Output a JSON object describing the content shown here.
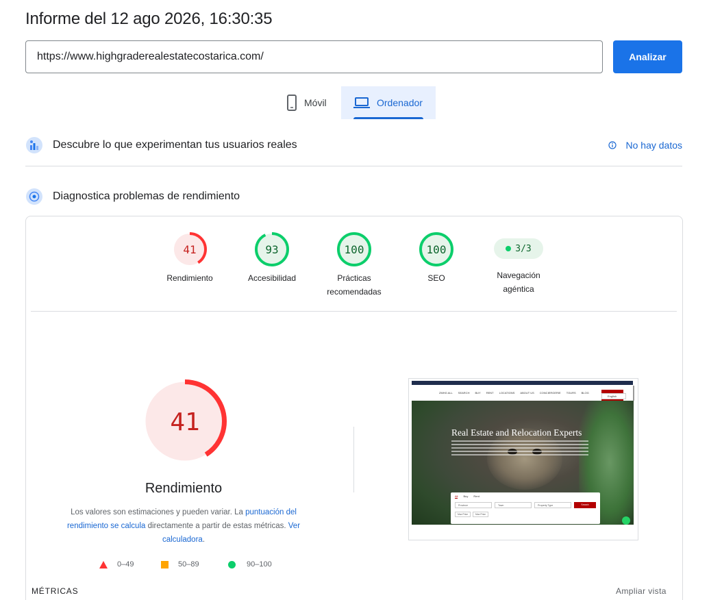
{
  "header": {
    "title": "Informe del 12 ago 2026, 16:30:35",
    "url_value": "https://www.highgraderealestatecostarica.com/",
    "analyze_label": "Analizar"
  },
  "device_tabs": {
    "mobile_label": "Móvil",
    "desktop_label": "Ordenador",
    "selected": "Ordenador"
  },
  "field_data": {
    "label": "Descubre lo que experimentan tus usuarios reales",
    "status": "No hay datos"
  },
  "lab": {
    "label": "Diagnostica problemas de rendimiento"
  },
  "scores": {
    "performance": {
      "value": "41",
      "label": "Rendimiento",
      "fraction": 0.41,
      "color": "#ff3333"
    },
    "accessibility": {
      "value": "93",
      "label": "Accesibilidad",
      "fraction": 0.93,
      "color": "#0cce6b"
    },
    "best_practices": {
      "value": "100",
      "label_line1": "Prácticas",
      "label_line2": "recomendadas",
      "fraction": 1.0,
      "color": "#0cce6b"
    },
    "seo": {
      "value": "100",
      "label": "SEO",
      "fraction": 1.0,
      "color": "#0cce6b"
    },
    "agentic": {
      "value": "3/3",
      "label_line1": "Navegación",
      "label_line2": "agéntica"
    }
  },
  "detail": {
    "score": "41",
    "label": "Rendimiento",
    "desc_prefix": "Los valores son estimaciones y pueden variar. La ",
    "desc_link1": "puntuación del rendimiento se calcula",
    "desc_middle": " directamente a partir de estas métricas. ",
    "desc_link2": "Ver calculadora",
    "desc_suffix": "."
  },
  "legend": {
    "fail": "0–49",
    "average": "50–89",
    "pass": "90–100"
  },
  "metrics": {
    "title": "MÉTRICAS",
    "expand": "Ampliar vista"
  },
  "thumbnail": {
    "nav_items": [
      "ZMHG ALL",
      "SEARCH",
      "BUY",
      "RENT",
      "LOCATIONS",
      "ABOUT US",
      "CONCIERGERIE",
      "TOURS",
      "BLOG"
    ],
    "headline": "Real Estate and Relocation Experts",
    "lang": "English",
    "tabs": [
      "All",
      "Buy",
      "Rent"
    ],
    "field1": "Province",
    "field2": "Town",
    "field3": "Property Type",
    "search_btn": "Search",
    "more1": "Max Price",
    "more2": "Max Price"
  },
  "colors": {
    "accent": "#1a73e8",
    "fail": "#ff3333",
    "fail_bg": "#fce8e8",
    "pass": "#0cce6b",
    "pass_bg": "#e6f4ea",
    "average": "#ffa400"
  }
}
